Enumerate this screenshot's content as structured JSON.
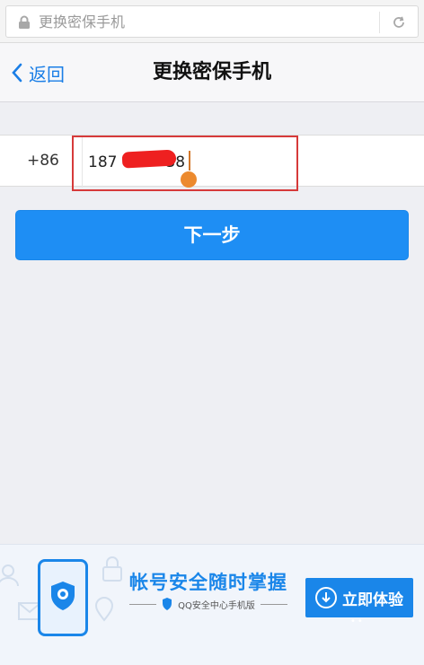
{
  "browser": {
    "url_text": "更换密保手机",
    "lock_icon": "lock-icon",
    "refresh_icon": "refresh-icon"
  },
  "header": {
    "back_label": "返回",
    "title": "更换密保手机"
  },
  "form": {
    "country_code": "+86",
    "phone_value": "187          38",
    "next_label": "下一步"
  },
  "banner": {
    "headline": "帐号安全随时掌握",
    "subline": "QQ安全中心手机版",
    "cta_label": "立即体验"
  },
  "colors": {
    "accent": "#1e8ef4",
    "highlight_border": "#d63a3a",
    "redaction": "#ee2020",
    "cursor_handle": "#ec8a2e"
  }
}
